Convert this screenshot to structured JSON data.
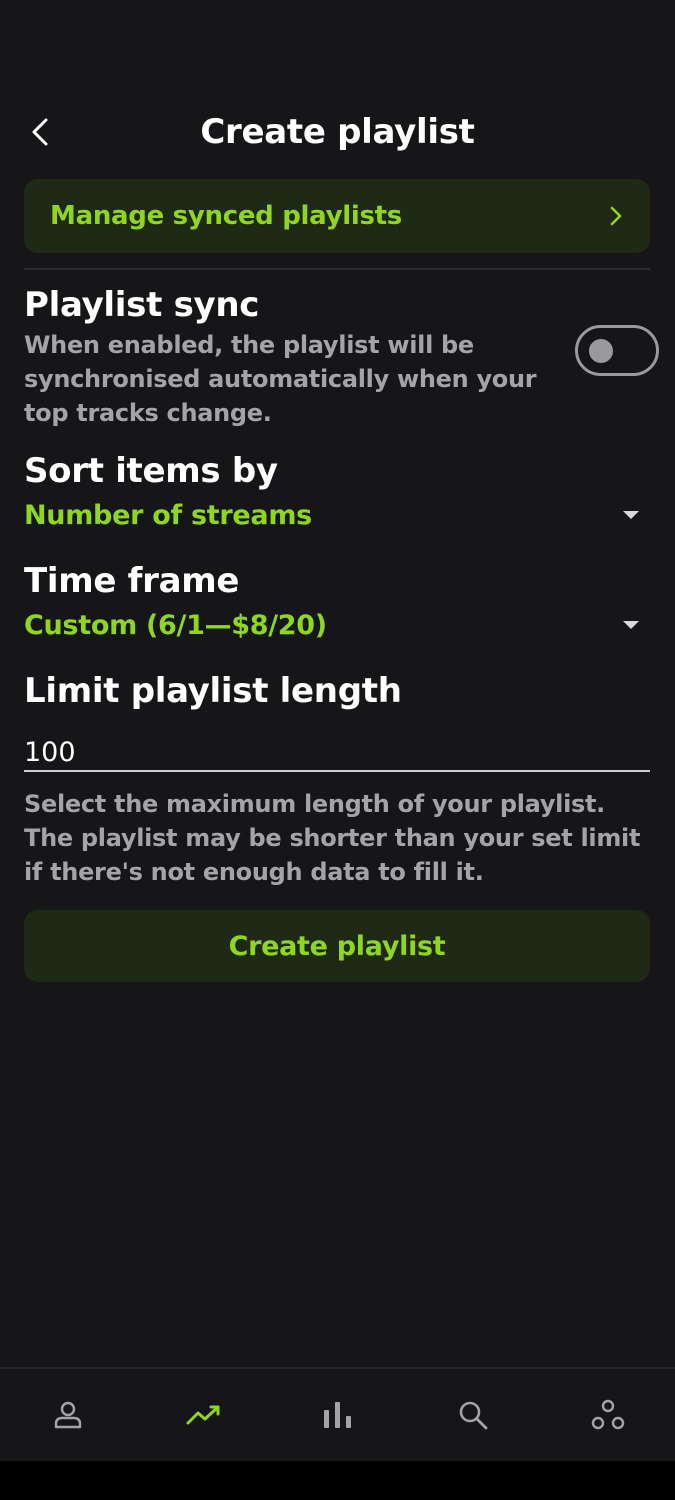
{
  "header": {
    "title": "Create playlist",
    "back_icon": "chevron-left-icon"
  },
  "manage": {
    "label": "Manage synced playlists",
    "icon": "chevron-right-icon"
  },
  "sync": {
    "title": "Playlist sync",
    "description": "When enabled, the playlist will be synchronised automatically when your top tracks change.",
    "enabled": false
  },
  "sort": {
    "title": "Sort items by",
    "value": "Number of streams"
  },
  "timeframe": {
    "title": "Time frame",
    "value": "Custom (6/1—$8/20)"
  },
  "limit": {
    "title": "Limit playlist length",
    "value": "100",
    "help": "Select the maximum length of your playlist. The playlist may be shorter than your set limit if there's not enough data to fill it."
  },
  "actions": {
    "create_label": "Create playlist"
  },
  "nav": {
    "items": [
      "profile-icon",
      "trend-icon",
      "bar-chart-icon",
      "search-icon",
      "friends-icon"
    ],
    "active": "trend-icon"
  },
  "colors": {
    "background": "#161618",
    "accent": "#8fd61e",
    "card": "#1f2a16",
    "muted_text": "#a4a4a8"
  }
}
